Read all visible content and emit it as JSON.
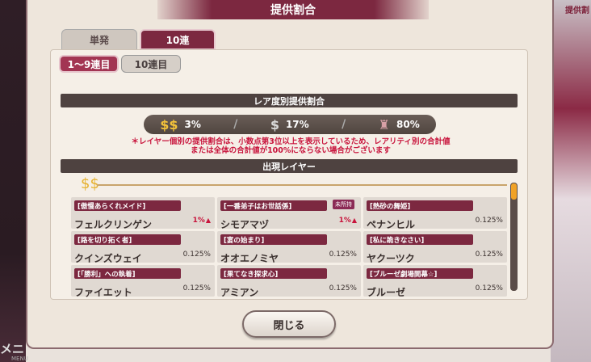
{
  "title": "提供割合",
  "tabs": {
    "single": "単発",
    "ten": "10連"
  },
  "subtabs": {
    "first": "1～9連目",
    "second": "10連目"
  },
  "rarity_section": {
    "heading": "レア度別提供割合",
    "rates": [
      {
        "rarity_icon": "ssr-icon",
        "value": "3%"
      },
      {
        "rarity_icon": "sr-icon",
        "value": "17%"
      },
      {
        "rarity_icon": "r-icon",
        "value": "80%"
      }
    ],
    "note_line1": "＊レイヤー個別の提供割合は、小数点第3位以上を表示しているため、レアリティ別の合計値",
    "note_line2": "または全体の合計値が100%にならない場合がございます"
  },
  "layers_section": {
    "heading": "出現レイヤー",
    "cards": [
      {
        "tag": "[傲慢あらくれメイド]",
        "name": "フェルクリンゲン",
        "rate": "1%",
        "up": true,
        "badge": ""
      },
      {
        "tag": "[一番弟子はお世話係]",
        "name": "シモアマヅ",
        "rate": "1%",
        "up": true,
        "badge": "未所持"
      },
      {
        "tag": "[熱砂の舞姫]",
        "name": "ペナンヒル",
        "rate": "0.125%",
        "up": false,
        "badge": ""
      },
      {
        "tag": "[路を切り拓く者]",
        "name": "クインズウェイ",
        "rate": "0.125%",
        "up": false,
        "badge": ""
      },
      {
        "tag": "[宴の始まり]",
        "name": "オオエノミヤ",
        "rate": "0.125%",
        "up": false,
        "badge": ""
      },
      {
        "tag": "[私に跪きなさい]",
        "name": "ヤクーツク",
        "rate": "0.125%",
        "up": false,
        "badge": ""
      },
      {
        "tag": "[「勝利」への執着]",
        "name": "ファイエット",
        "rate": "0.125%",
        "up": false,
        "badge": ""
      },
      {
        "tag": "[果てなき探求心]",
        "name": "アミアン",
        "rate": "0.125%",
        "up": false,
        "badge": ""
      },
      {
        "tag": "[ブルーゼ劇場開幕☆]",
        "name": "ブルーゼ",
        "rate": "0.125%",
        "up": false,
        "badge": ""
      }
    ]
  },
  "close_label": "閉じる",
  "background": {
    "menu_label": "メニ",
    "menu_sub": "MENU",
    "corner_text": "提供割"
  }
}
